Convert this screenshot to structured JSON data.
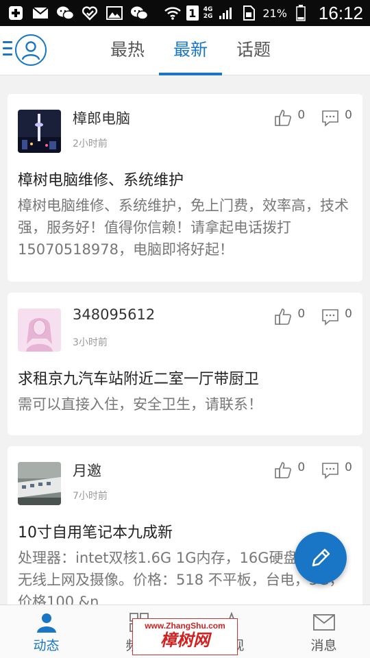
{
  "status_bar": {
    "sim": "1",
    "net_top": "4G",
    "net_bottom": "2G",
    "battery": "21%",
    "time": "16:12"
  },
  "header": {
    "tabs": [
      {
        "label": "最热",
        "active": false
      },
      {
        "label": "最新",
        "active": true
      },
      {
        "label": "话题",
        "active": false
      }
    ]
  },
  "posts": [
    {
      "author": "樟郎电脑",
      "time": "2小时前",
      "likes": "0",
      "comments": "0",
      "title": "樟树电脑维修、系统维护",
      "body": "樟树电脑维修、系统维护，免上门费，效率高，技术强，服务好！值得你信赖！请拿起电话拨打15070518978，电脑即将好起！"
    },
    {
      "author": "348095612",
      "time": "3小时前",
      "likes": "0",
      "comments": "0",
      "title": "求租京九汽车站附近二室一厅带厨卫",
      "body": "需可以直接入住，安全卫生，请联系！"
    },
    {
      "author": "月邀",
      "time": "7小时前",
      "likes": "0",
      "comments": "0",
      "title": "10寸自用笔记本九成新",
      "body": "处理器：intet双核1.6G 1G内存，16G硬盘，支持无线上网及摄像。价格：518 不平板，台电，5G，价格100 &n"
    }
  ],
  "bottom_nav": [
    {
      "label": "动态",
      "active": true,
      "icon": "person-icon"
    },
    {
      "label": "频道",
      "active": false,
      "icon": "grid-icon"
    },
    {
      "label": "发现",
      "active": false,
      "icon": "compass-icon"
    },
    {
      "label": "消息",
      "active": false,
      "icon": "mail-icon"
    }
  ],
  "watermark": {
    "url": "www.ZhangShu.com",
    "name": "樟树网"
  },
  "colors": {
    "accent": "#1976c6",
    "background": "#f2f2f2",
    "status_bar": "#0b0b0b",
    "watermark": "#d02020"
  }
}
